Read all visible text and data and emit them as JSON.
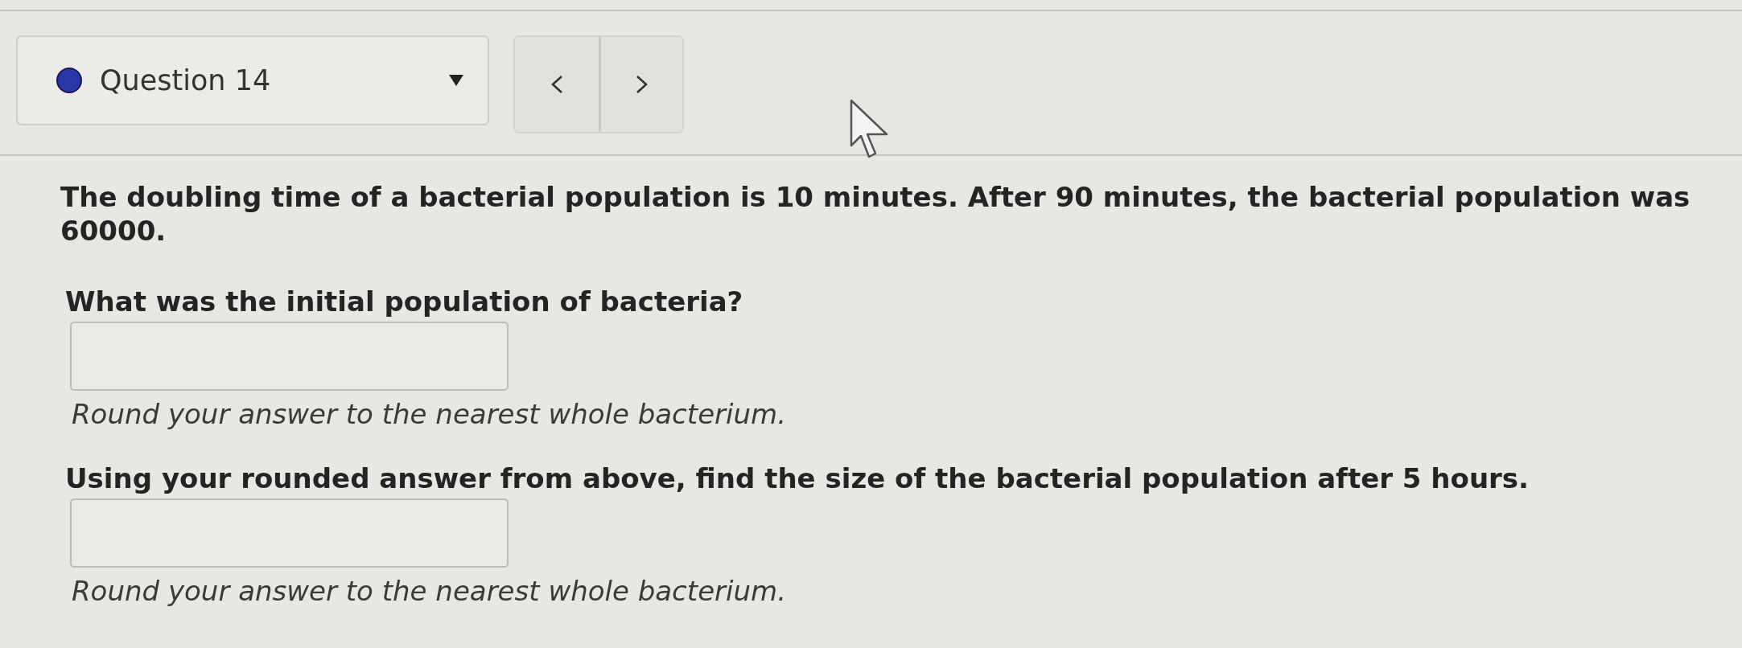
{
  "question_selector": {
    "label": "Question 14"
  },
  "question": {
    "text": "The doubling time of a bacterial population is 10 minutes. After 90 minutes, the bacterial population was 60000.",
    "parts": [
      {
        "prompt": "What was the initial population of bacteria?",
        "hint": "Round your answer to the nearest whole bacterium."
      },
      {
        "prompt": "Using your rounded answer from above, find the size of the bacterial population after 5 hours.",
        "hint": "Round your answer to the nearest whole bacterium."
      }
    ]
  }
}
